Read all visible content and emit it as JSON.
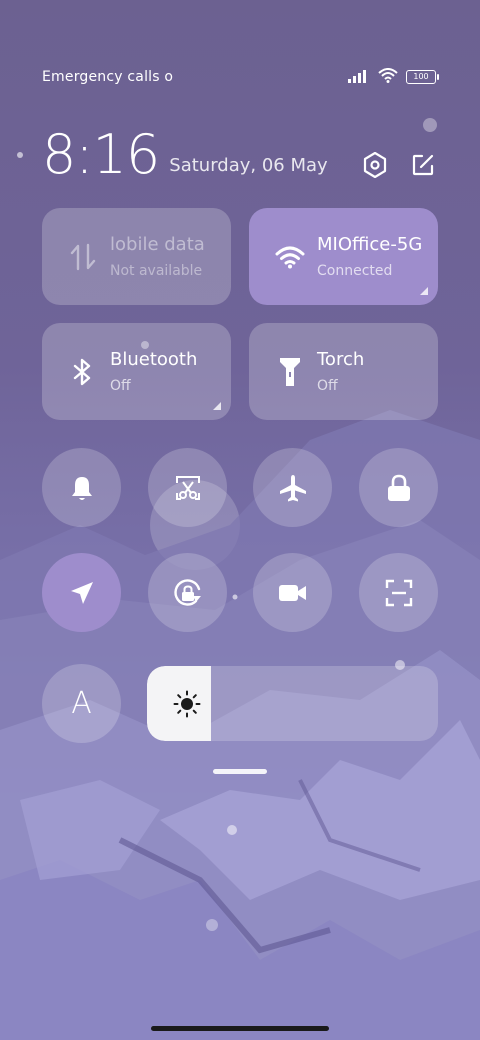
{
  "status_bar": {
    "carrier_text": "Emergency calls o",
    "battery_level": "100"
  },
  "header": {
    "time": "8:16",
    "date": "Saturday, 06 May"
  },
  "tiles": {
    "mobile_data": {
      "label": "lobile data",
      "status": "Not available",
      "icon": "mobile-data-icon",
      "enabled": false
    },
    "wifi": {
      "label": "MIOffice-5G",
      "status": "Connected",
      "icon": "wifi-icon",
      "active": true
    },
    "bluetooth": {
      "label": "Bluetooth",
      "status": "Off",
      "icon": "bluetooth-icon",
      "active": false
    },
    "torch": {
      "label": "Torch",
      "status": "Off",
      "icon": "torch-icon",
      "active": false
    }
  },
  "toggles_row1": [
    "bell-icon",
    "screenshot-scissors-icon",
    "airplane-icon",
    "lock-icon"
  ],
  "toggles_row2": [
    "location-icon",
    "rotation-lock-icon",
    "video-camera-icon",
    "scan-icon"
  ],
  "toggles_row3": [
    "auto-brightness-icon"
  ],
  "auto_brightness_label": "A",
  "brightness": {
    "level_fraction": 0.22
  },
  "colors": {
    "accent": "#9e8dcc",
    "background_top": "#6c6191",
    "background_bottom": "#9b98d2"
  }
}
